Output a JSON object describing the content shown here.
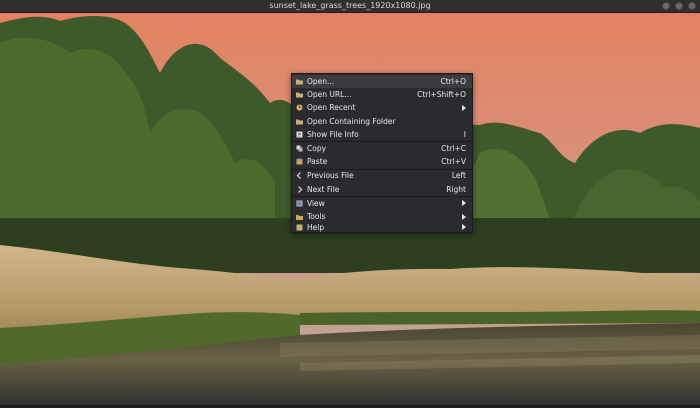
{
  "window": {
    "title": "sunset_lake_grass_trees_1920x1080.jpg"
  },
  "context_menu": {
    "items": [
      {
        "label": "Open...",
        "shortcut": "Ctrl+O",
        "icon": "folder-open-icon"
      },
      {
        "label": "Open URL...",
        "shortcut": "Ctrl+Shift+O",
        "icon": "folder-open-icon"
      },
      {
        "label": "Open Recent",
        "shortcut": "",
        "icon": "clock-icon",
        "submenu": true
      },
      {
        "label": "Open Containing Folder",
        "shortcut": "",
        "icon": "folder-open-icon"
      },
      {
        "label": "Show File Info",
        "shortcut": "I",
        "icon": "info-icon"
      },
      {
        "label": "Copy",
        "shortcut": "Ctrl+C",
        "icon": "copy-icon"
      },
      {
        "label": "Paste",
        "shortcut": "Ctrl+V",
        "icon": "paste-icon"
      },
      {
        "label": "Previous File",
        "shortcut": "Left",
        "icon": "arrow-left-icon"
      },
      {
        "label": "Next File",
        "shortcut": "Right",
        "icon": "arrow-right-icon"
      },
      {
        "label": "View",
        "shortcut": "",
        "icon": "view-icon",
        "submenu": true
      },
      {
        "label": "Tools",
        "shortcut": "",
        "icon": "tools-icon",
        "submenu": true
      },
      {
        "label": "Help",
        "shortcut": "",
        "icon": "help-icon",
        "submenu": true
      }
    ]
  },
  "colors": {
    "menu_bg": "#2a2b2e",
    "menu_text": "#e8e8e8",
    "titlebar_bg": "#2f2f2f"
  }
}
